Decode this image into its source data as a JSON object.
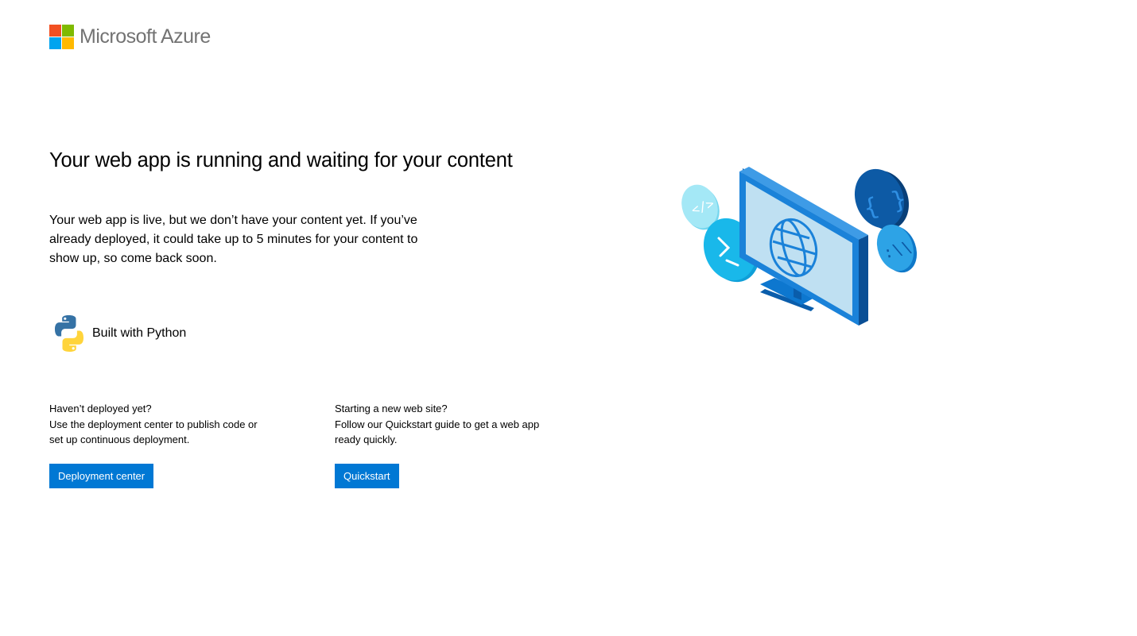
{
  "brand": {
    "name": "Microsoft Azure",
    "logo_colors": [
      "#f25022",
      "#7fba00",
      "#00a4ef",
      "#ffb900"
    ]
  },
  "headline": "Your web app is running and waiting for your content",
  "intro": "Your web app is live, but we don’t have your content yet. If you’ve already deployed, it could take up to 5 minutes for your content to show up, so come back soon.",
  "stack": {
    "icon": "python-logo-icon",
    "label": "Built with Python"
  },
  "deploy": {
    "heading": "Haven’t deployed yet?",
    "body": "Use the deployment center to publish code or set up continuous deployment.",
    "button_label": "Deployment center"
  },
  "quickstart": {
    "heading": "Starting a new web site?",
    "body": "Follow our Quickstart guide to get a web app ready quickly.",
    "button_label": "Quickstart"
  },
  "illustration": {
    "icon": "monitor-globe-illustration",
    "accent": "#0078d4"
  }
}
